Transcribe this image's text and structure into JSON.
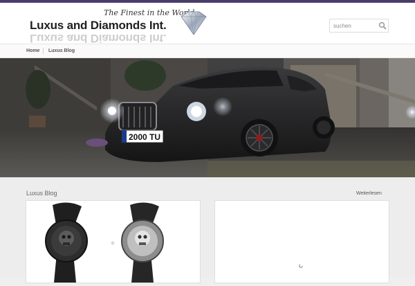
{
  "header": {
    "logo_tagline": "The Finest in the World",
    "logo_name": "Luxus and Diamonds Int.",
    "accent_color": "#4a3d6b",
    "search": {
      "placeholder": "suchen",
      "icon": "search-icon"
    }
  },
  "breadcrumb": {
    "items": [
      {
        "label": "Home"
      },
      {
        "label": "Luxus Blog"
      }
    ]
  },
  "hero": {
    "plate_text": "2000 TU"
  },
  "blog": {
    "title": "Luxus Blog",
    "read_more": "Weiterlesen"
  }
}
